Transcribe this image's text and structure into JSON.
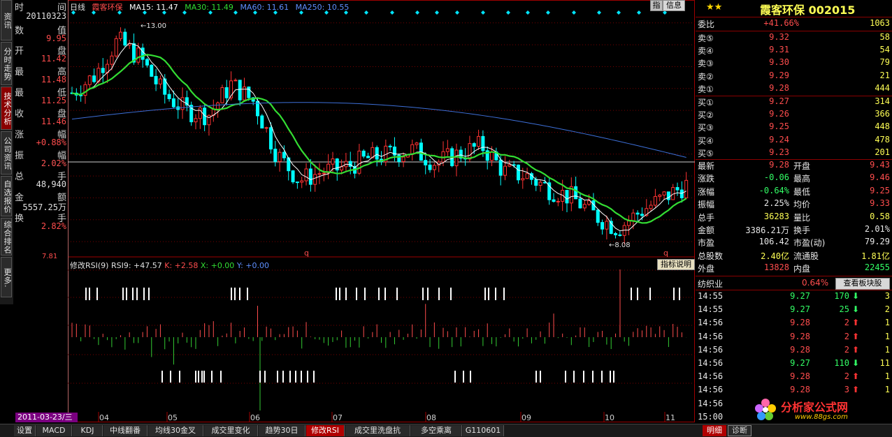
{
  "side_tabs": [
    "资讯",
    "分时走势",
    "技术分析",
    "公司资讯",
    "自选报价",
    "综合排名",
    "更多."
  ],
  "side_tab_active": 2,
  "info": {
    "time_label_l": "时",
    "time_label_r": "间",
    "date": "20110323",
    "value_label_l": "数",
    "value_label_r": "值",
    "value": "9.95",
    "open_l": "开",
    "open_r": "盘",
    "open": "11.42",
    "high_l": "最",
    "high_r": "高",
    "high": "11.48",
    "low_l": "最",
    "low_r": "低",
    "low": "11.25",
    "close_l": "收",
    "close_r": "盘",
    "close": "11.46",
    "chg_l": "涨",
    "chg_r": "幅",
    "chg": "+0.88%",
    "amp_l": "振",
    "amp_r": "幅",
    "amp": "2.02%",
    "vol_l": "总",
    "vol_r": "手",
    "vol": "48,940",
    "amt_l": "金",
    "amt_r": "额",
    "amt": "5557.25万",
    "turn_l": "换",
    "turn_r": "手",
    "turn": "2.82%",
    "bottom_price": "7.81"
  },
  "header": {
    "period": "日线",
    "name": "霞客环保",
    "ma15": "MA15: 11.47",
    "ma30": "MA30: 11.49",
    "ma60": "MA60: 11.61",
    "ma250": "MA250: 10.55",
    "btn_zhi": "指",
    "btn_info": "信息"
  },
  "price_chart": {
    "y_range": [
      7.81,
      13.3
    ],
    "high_label": "13.00",
    "low_label": "8.08",
    "marker": "q",
    "x_ticks": [
      "04",
      "05",
      "06",
      "07",
      "08",
      "09",
      "10",
      "11"
    ]
  },
  "rsi_chart": {
    "title": "修改RSI(9)",
    "rsi": "RSI9: +47.57",
    "k": "K: +2.58",
    "x": "X: +0.00",
    "y": "Y: +0.00",
    "explain_btn": "指标说明",
    "y_ticks": [
      "+28.52",
      "+16.67",
      "+4.52",
      "-7.63",
      "-19.77"
    ]
  },
  "date_box": "2011-03-23/三",
  "bottom_tabs": [
    "设置",
    "MACD",
    "KDJ",
    "中线翻番",
    "均线30金叉",
    "成交里变化",
    "趋势30日",
    "修改RSI",
    "成交里洗盘抗",
    "多空乘离",
    "G110601"
  ],
  "bottom_tab_active": 7,
  "quote": {
    "stars": "★★",
    "title": "霞客环保 002015",
    "webi_l": "委比",
    "webi": "+41.66%",
    "webi_v": "1063",
    "sells": [
      [
        "卖⑤",
        "9.32",
        "58"
      ],
      [
        "卖④",
        "9.31",
        "54"
      ],
      [
        "卖③",
        "9.30",
        "79"
      ],
      [
        "卖②",
        "9.29",
        "21"
      ],
      [
        "卖①",
        "9.28",
        "444"
      ]
    ],
    "buys": [
      [
        "买①",
        "9.27",
        "314"
      ],
      [
        "买②",
        "9.26",
        "366"
      ],
      [
        "买③",
        "9.25",
        "448"
      ],
      [
        "买④",
        "9.24",
        "478"
      ],
      [
        "买⑤",
        "9.23",
        "201"
      ]
    ],
    "stats": [
      [
        "最新",
        "9.28",
        "开盘",
        "9.43"
      ],
      [
        "涨跌",
        "-0.06",
        "最高",
        "9.46"
      ],
      [
        "涨幅",
        "-0.64%",
        "最低",
        "9.25"
      ],
      [
        "振幅",
        "2.25%",
        "均价",
        "9.33"
      ],
      [
        "总手",
        "36283",
        "量比",
        "0.58"
      ],
      [
        "金额",
        "3386.21万",
        "换手",
        "2.01%"
      ],
      [
        "市盈",
        "106.42",
        "市盈(动)",
        "79.29"
      ],
      [
        "总股数",
        "2.40亿",
        "流通股",
        "1.81亿"
      ],
      [
        "外盘",
        "13828",
        "内盘",
        "22455"
      ]
    ],
    "sector": "纺织业",
    "sector_pct": "0.64%",
    "sector_btn": "查看板块股",
    "ticks": [
      [
        "14:55",
        "9.27",
        "170",
        "down",
        "3"
      ],
      [
        "14:55",
        "9.27",
        "25",
        "down",
        "2"
      ],
      [
        "14:56",
        "9.28",
        "2",
        "up",
        "1"
      ],
      [
        "14:56",
        "9.28",
        "2",
        "up",
        "1"
      ],
      [
        "14:56",
        "9.28",
        "2",
        "up",
        "1"
      ],
      [
        "14:56",
        "9.27",
        "110",
        "down",
        "11"
      ],
      [
        "14:56",
        "9.28",
        "2",
        "up",
        "1"
      ],
      [
        "14:56",
        "9.28",
        "3",
        "up",
        "1"
      ],
      [
        "14:56",
        "",
        "",
        "",
        ""
      ],
      [
        "15:00",
        "",
        "",
        "",
        ""
      ]
    ],
    "tab_detail": "明细",
    "tab_diag": "诊断",
    "logo_text": "分析家公式网",
    "logo_url": "www.88gs.com"
  },
  "colors": {
    "up": "#ff3333",
    "down": "#00ffff",
    "ma15": "#ffffff",
    "ma30": "#33dd33",
    "ma250": "#3d6fd8",
    "grid": "#8a0000"
  }
}
